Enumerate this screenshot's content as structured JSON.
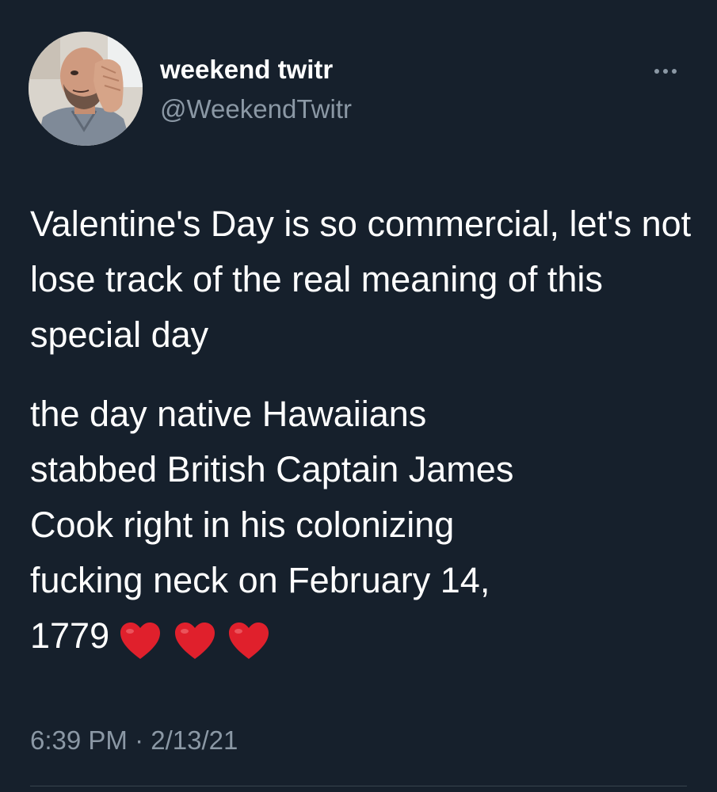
{
  "author": {
    "display_name": "weekend twitr",
    "handle": "@WeekendTwitr",
    "avatar_icon": "profile-photo"
  },
  "more_icon": "ellipsis-icon",
  "tweet": {
    "paragraph_1": "Valentine's Day is so commercial, let's not lose track of the real meaning of this special day",
    "paragraph_2_lines": [
      "the day native Hawaiians",
      "stabbed British Captain James",
      "Cook right in his colonizing",
      "fucking neck on February 14,"
    ],
    "year": "1779",
    "emoji": [
      "red-heart-icon",
      "red-heart-icon",
      "red-heart-icon"
    ]
  },
  "timestamp": "6:39 PM · 2/13/21",
  "colors": {
    "background": "#16202c",
    "text": "#ffffff",
    "secondary_text": "#8b98a5",
    "heart": "#e0202c"
  }
}
